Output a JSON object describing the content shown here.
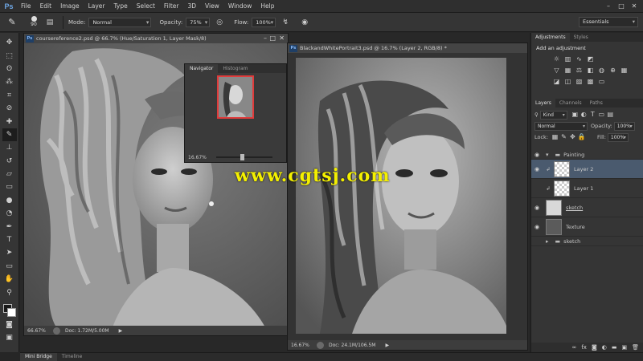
{
  "menubar": {
    "logo": "Ps",
    "items": [
      "File",
      "Edit",
      "Image",
      "Layer",
      "Type",
      "Select",
      "Filter",
      "3D",
      "View",
      "Window",
      "Help"
    ]
  },
  "options": {
    "brush_size": "90",
    "mode_label": "Mode:",
    "mode_value": "Normal",
    "opacity_label": "Opacity:",
    "opacity_value": "75%",
    "flow_label": "Flow:",
    "flow_value": "100%",
    "workspace": "Essentials"
  },
  "doc1": {
    "title": "coursereference2.psd @ 66.7% (Hue/Saturation 1, Layer Mask/8)",
    "zoom": "66.67%",
    "doc_size": "Doc: 1.72M/5.00M"
  },
  "doc2": {
    "title": "BlackandWhitePortrait3.psd @ 16.7% (Layer 2, RGB/8) *",
    "zoom": "16.67%",
    "doc_size": "Doc: 24.1M/106.5M"
  },
  "navigator": {
    "tabs": [
      "Navigator",
      "Histogram"
    ],
    "zoom": "16.67%"
  },
  "adjustments": {
    "tabs": [
      "Adjustments",
      "Styles"
    ],
    "title": "Add an adjustment"
  },
  "layers": {
    "tabs": [
      "Layers",
      "Channels",
      "Paths"
    ],
    "filter_kind": "Kind",
    "blend_mode": "Normal",
    "opacity_label": "Opacity:",
    "opacity_value": "100%",
    "lock_label": "Lock:",
    "fill_label": "Fill:",
    "fill_value": "100%",
    "items": [
      {
        "name": "Painting"
      },
      {
        "name": "Layer 2"
      },
      {
        "name": "Layer 1"
      },
      {
        "name": "sketch"
      },
      {
        "name": "Texture"
      },
      {
        "name": "sketch"
      }
    ]
  },
  "bottom": {
    "tabs": [
      "Mini Bridge",
      "Timeline"
    ]
  },
  "watermark": "www.cgtsj.com",
  "icons": {
    "brush": "brush-icon",
    "close": "close-icon",
    "eye": "eye-icon",
    "folder": "folder-icon"
  }
}
